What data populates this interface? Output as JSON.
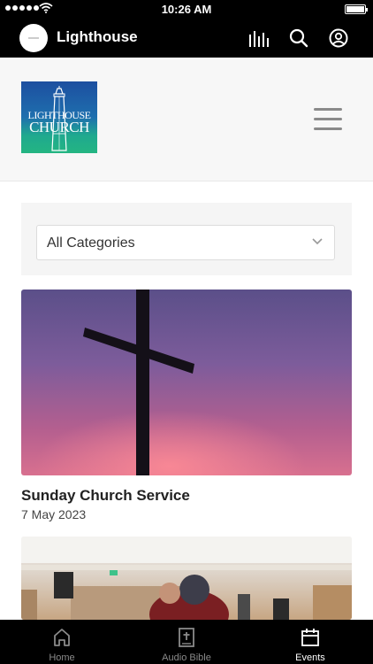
{
  "status_bar": {
    "time": "10:26 AM"
  },
  "app": {
    "title": "Lighthouse"
  },
  "header_icons": [
    "audio-levels-icon",
    "search-icon",
    "account-icon"
  ],
  "site": {
    "logo_line1": "LIGHTHOUSE",
    "logo_line2": "CHURCH"
  },
  "filter": {
    "selected": "All Categories"
  },
  "events": [
    {
      "title": "Sunday Church Service",
      "date": "7 May 2023"
    }
  ],
  "tabs": [
    {
      "label": "Home",
      "icon": "home-icon",
      "active": false
    },
    {
      "label": "Audio Bible",
      "icon": "bible-icon",
      "active": false
    },
    {
      "label": "Events",
      "icon": "calendar-icon",
      "active": true
    }
  ],
  "colors": {
    "bar_background": "#000000",
    "active_tab": "#ffffff",
    "inactive_tab": "#8a8a8a",
    "logo_blue": "#1d4fa0",
    "logo_green": "#24b582"
  }
}
